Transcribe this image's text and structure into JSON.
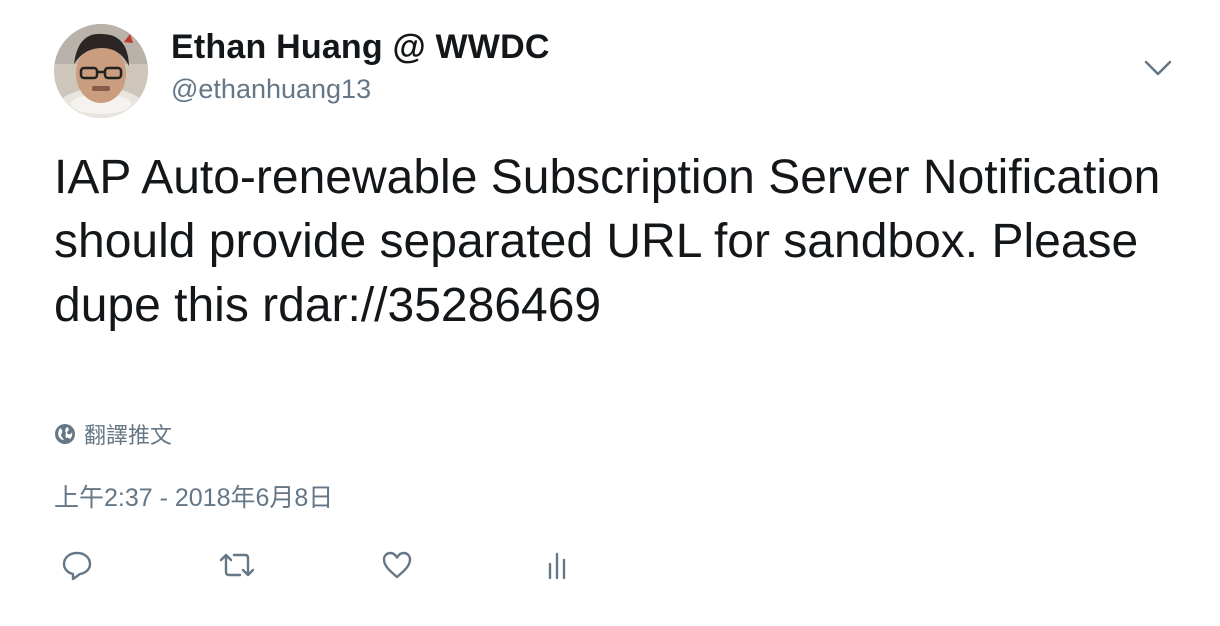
{
  "tweet": {
    "author": {
      "name": "Ethan Huang @ WWDC",
      "handle": "@ethanhuang13"
    },
    "text": "IAP Auto-renewable Subscription Server Notification should provide separated URL for sandbox. Please dupe this rdar://35286469",
    "translate_label": "翻譯推文",
    "timestamp": "上午2:37 - 2018年6月8日"
  },
  "icons": {
    "menu": "chevron-down-icon",
    "translate": "globe-icon",
    "reply": "reply-icon",
    "retweet": "retweet-icon",
    "like": "heart-icon",
    "analytics": "analytics-icon"
  },
  "colors": {
    "text": "#14171a",
    "secondary": "#657786",
    "icon": "#657786"
  }
}
